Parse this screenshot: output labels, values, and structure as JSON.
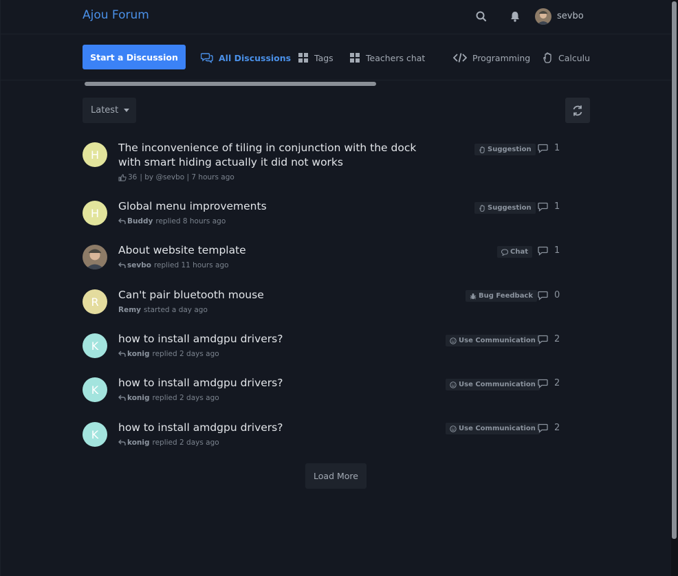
{
  "header": {
    "brand": "Ajou Forum",
    "username": "sevbo",
    "icons": [
      "search-icon",
      "bell-icon"
    ]
  },
  "nav": {
    "start_label": "Start a Discussion",
    "items": [
      {
        "label": "All Discussions",
        "icon": "comments-icon",
        "active": true
      },
      {
        "label": "Tags",
        "icon": "grid-icon"
      },
      {
        "label": "Teachers chat",
        "icon": "grid-icon"
      },
      {
        "label": "Programming",
        "icon": "code-icon"
      },
      {
        "label": "Calculus",
        "icon": "hand-icon"
      }
    ]
  },
  "toolbar": {
    "sort_label": "Latest"
  },
  "discussions": [
    {
      "avatar_letter": "H",
      "avatar_color": "#e2e49c",
      "title": "The inconvenience of tiling in conjunction with the dock with smart hiding actually it did not works",
      "meta_likes": "36",
      "meta_text": "| by @sevbo | 7 hours ago",
      "tag": "Suggestion",
      "replies": "1"
    },
    {
      "avatar_letter": "H",
      "avatar_color": "#e2e49c",
      "title": "Global menu improvements",
      "meta_user": "Buddy",
      "meta_text": "replied 8 hours ago",
      "tag": "Suggestion",
      "replies": "1"
    },
    {
      "avatar_letter": "",
      "avatar_color": "#7a6a58",
      "title": "About website template",
      "meta_user": "sevbo",
      "meta_text": "replied 11 hours ago",
      "tag": "Chat",
      "replies": "1"
    },
    {
      "avatar_letter": "R",
      "avatar_color": "#e4dc9e",
      "title": "Can't pair bluetooth mouse",
      "meta_user": "Remy",
      "meta_text": "started a day ago",
      "tag": "Bug Feedback",
      "replies": "0"
    },
    {
      "avatar_letter": "K",
      "avatar_color": "#a3e4de",
      "title": "how to install amdgpu drivers?",
      "meta_user": "konig",
      "meta_text": "replied 2 days ago",
      "tag": "Use Communication",
      "replies": "2"
    },
    {
      "avatar_letter": "K",
      "avatar_color": "#a3e4de",
      "title": "how to install amdgpu drivers?",
      "meta_user": "konig",
      "meta_text": "replied 2 days ago",
      "tag": "Use Communication",
      "replies": "2"
    },
    {
      "avatar_letter": "K",
      "avatar_color": "#a3e4de",
      "title": "how to install amdgpu drivers?",
      "meta_user": "konig",
      "meta_text": "replied 2 days ago",
      "tag": "Use Communication",
      "replies": "2"
    }
  ],
  "load_more_label": "Load More",
  "colors": {
    "accent": "#3b82f6",
    "brand": "#4a90e8",
    "background": "#141821"
  }
}
